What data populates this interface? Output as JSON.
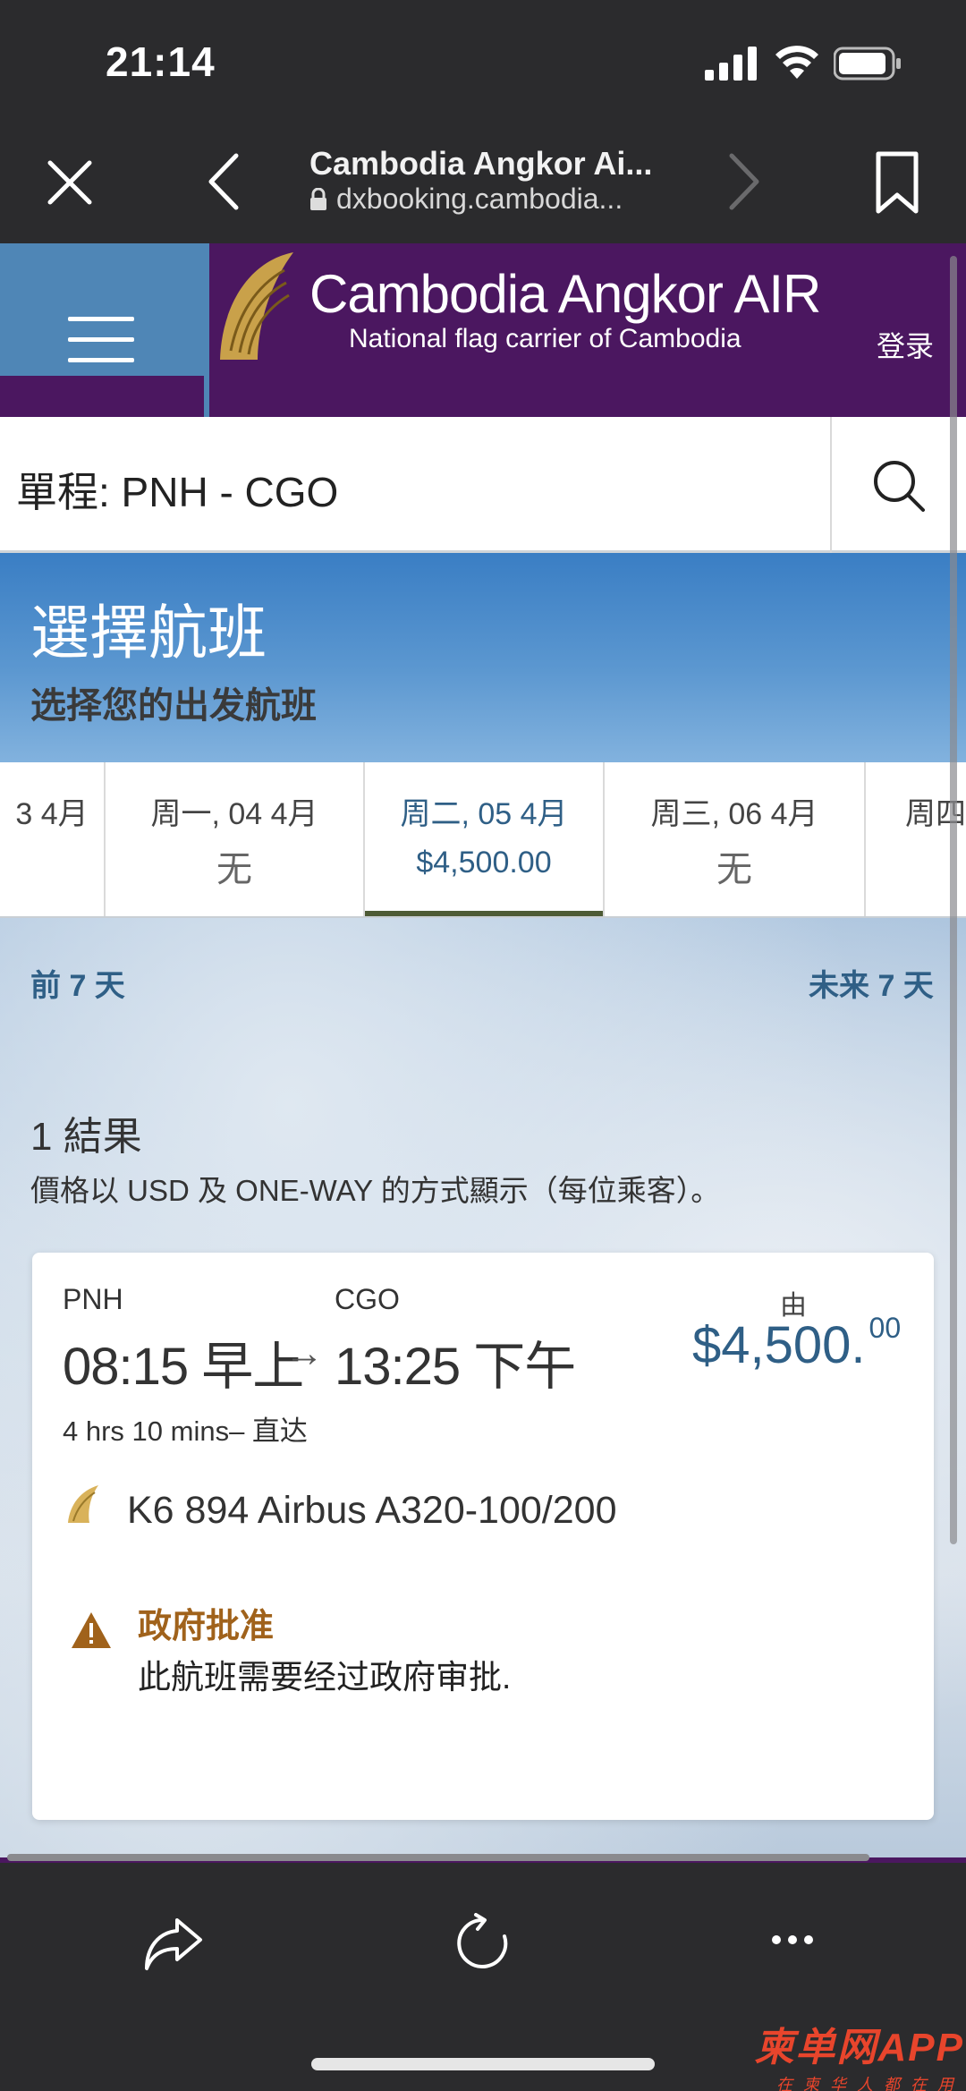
{
  "status_bar": {
    "time": "21:14"
  },
  "browser": {
    "tab_title": "Cambodia Angkor Ai...",
    "url": "dxbooking.cambodia..."
  },
  "site_header": {
    "brand_name": "Cambodia Angkor AIR",
    "tagline": "National flag carrier of Cambodia",
    "login": "登录",
    "colors": {
      "purple": "#4b1760",
      "blue": "#4f86b6",
      "gold": "#c9a14a"
    }
  },
  "route": {
    "label": "單程: PNH - CGO"
  },
  "hero": {
    "title": "選擇航班",
    "subtitle": "选择您的出发航班"
  },
  "dates": [
    {
      "label": "3 4月",
      "price": ""
    },
    {
      "label": "周一, 04 4月",
      "price": "无"
    },
    {
      "label": "周二, 05 4月",
      "price": "$4,500.00",
      "selected": true
    },
    {
      "label": "周三, 06 4月",
      "price": "无"
    },
    {
      "label": "周四",
      "price": ""
    }
  ],
  "nav": {
    "prev": "前 7 天",
    "next": "未来 7 天"
  },
  "results": {
    "count": "1 結果",
    "note": "價格以 USD 及 ONE-WAY 的方式顯示（每位乘客）。"
  },
  "flight": {
    "from_code": "PNH",
    "to_code": "CGO",
    "departure": "08:15 早上",
    "arrow": "→",
    "arrival": "13:25 下午",
    "duration": "4 hrs 10 mins– 直达",
    "from_label": "由",
    "price_main": "$4,500.",
    "price_cents": "00",
    "flight_info": "K6 894 Airbus A320-100/200",
    "warning_title": "政府批准",
    "warning_text": "此航班需要经过政府审批."
  },
  "watermark": {
    "main": "柬单网APP",
    "sub": "在柬华人都在用"
  },
  "icons": [
    "close-icon",
    "back-icon",
    "forward-icon",
    "bookmark-icon",
    "lock-icon",
    "menu-icon",
    "search-icon",
    "warning-icon",
    "share-icon",
    "reload-icon",
    "more-icon"
  ]
}
